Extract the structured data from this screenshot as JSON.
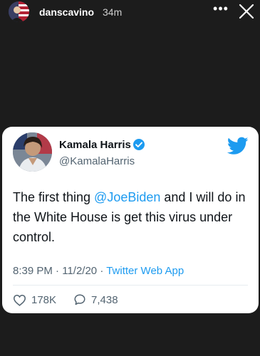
{
  "story": {
    "username": "danscavino",
    "time_ago": "34m",
    "more_icon": "ellipsis-icon",
    "close_icon": "close-icon"
  },
  "tweet": {
    "display_name": "Kamala Harris",
    "handle": "@KamalaHarris",
    "verified": true,
    "text_before": "The first thing ",
    "mention": "@JoeBiden",
    "text_after": " and I will do in the White House is get this virus under control.",
    "time": "8:39 PM",
    "sep1": " · ",
    "date": "11/2/20",
    "sep2": " · ",
    "source": "Twitter Web App",
    "likes": "178K",
    "replies": "7,438"
  },
  "colors": {
    "background": "#1c1c1c",
    "card": "#ffffff",
    "twitter_blue": "#1d9bf0",
    "text_primary": "#0f1419",
    "text_secondary": "#536471"
  }
}
